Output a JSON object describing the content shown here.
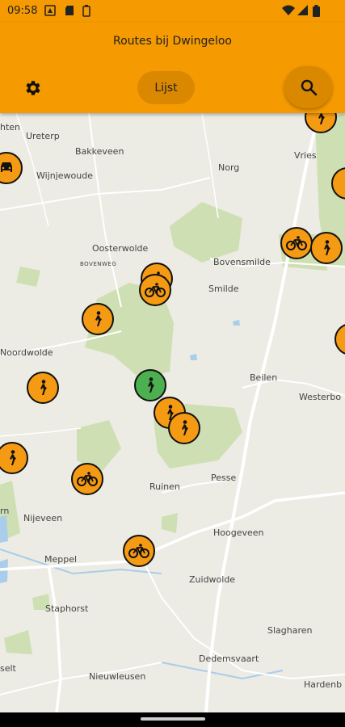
{
  "status": {
    "time": "09:58"
  },
  "app": {
    "title": "Routes bij Dwingeloo",
    "list_button": "Lijst",
    "settings_icon": "gear-icon",
    "search_icon": "search-icon"
  },
  "map": {
    "places": [
      "Ureterp",
      "Bakkeveen",
      "Wijnjewoude",
      "Norg",
      "Vries",
      "Oosterwolde",
      "BOVENWEG",
      "Bovensmilde",
      "Smilde",
      "Noordwolde",
      "Beilen",
      "Westerbo",
      "Ruinen",
      "Pesse",
      "Nijeveen",
      "Hoogeveen",
      "Meppel",
      "Zuidwolde",
      "Staphorst",
      "Slagharen",
      "Dedemsvaart",
      "Nieuwleusen",
      "Hardenb",
      "selt",
      "rn",
      "hten"
    ],
    "marker_types": {
      "walk": "walking-person-icon",
      "bike": "bicycle-icon",
      "car": "car-icon"
    },
    "colors": {
      "marker": "#f59a13",
      "selected_marker": "#4caf50",
      "appbar": "#f59a00"
    }
  }
}
